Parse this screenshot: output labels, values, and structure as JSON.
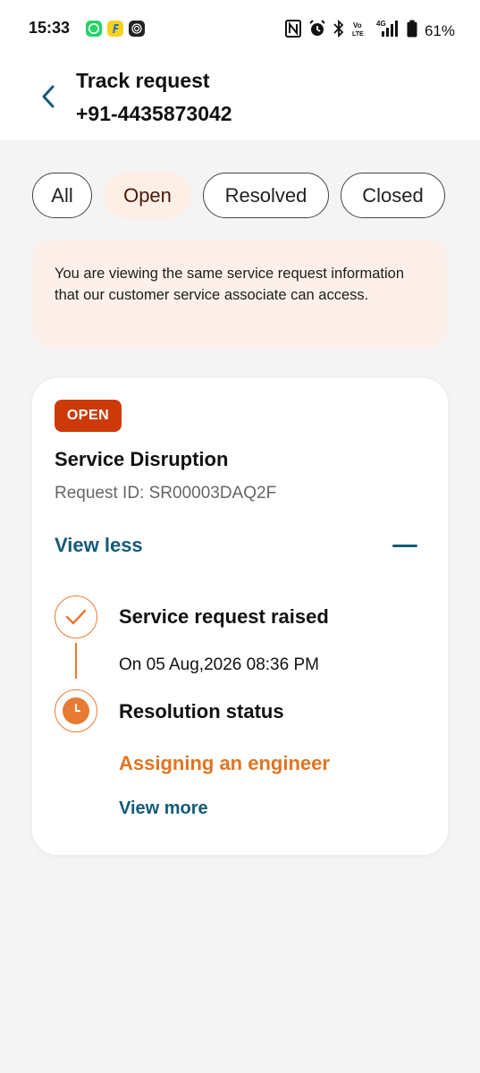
{
  "status_bar": {
    "time": "15:33",
    "network": "4G",
    "battery": "61%"
  },
  "header": {
    "title": "Track request",
    "phone": "+91-4435873042"
  },
  "filters": [
    {
      "label": "All",
      "active": false
    },
    {
      "label": "Open",
      "active": true
    },
    {
      "label": "Resolved",
      "active": false
    },
    {
      "label": "Closed",
      "active": false
    }
  ],
  "info_message": "You are viewing the same service request information that our customer service associate can access.",
  "request": {
    "status_badge": "OPEN",
    "title": "Service Disruption",
    "request_id": "Request ID: SR00003DAQ2F",
    "view_less_label": "View less",
    "timeline": [
      {
        "title": "Service request raised",
        "subtitle": "On 05 Aug,2026 08:36 PM",
        "icon": "check-icon"
      },
      {
        "title": "Resolution status",
        "status": "Assigning an engineer",
        "icon": "clock-icon"
      }
    ],
    "view_more_label": "View more"
  },
  "colors": {
    "accent": "#e87a33",
    "badge": "#cc3a0a",
    "link": "#145a7a",
    "info_bg": "#fdf0ea",
    "chip_active_bg": "#fdeee6"
  }
}
